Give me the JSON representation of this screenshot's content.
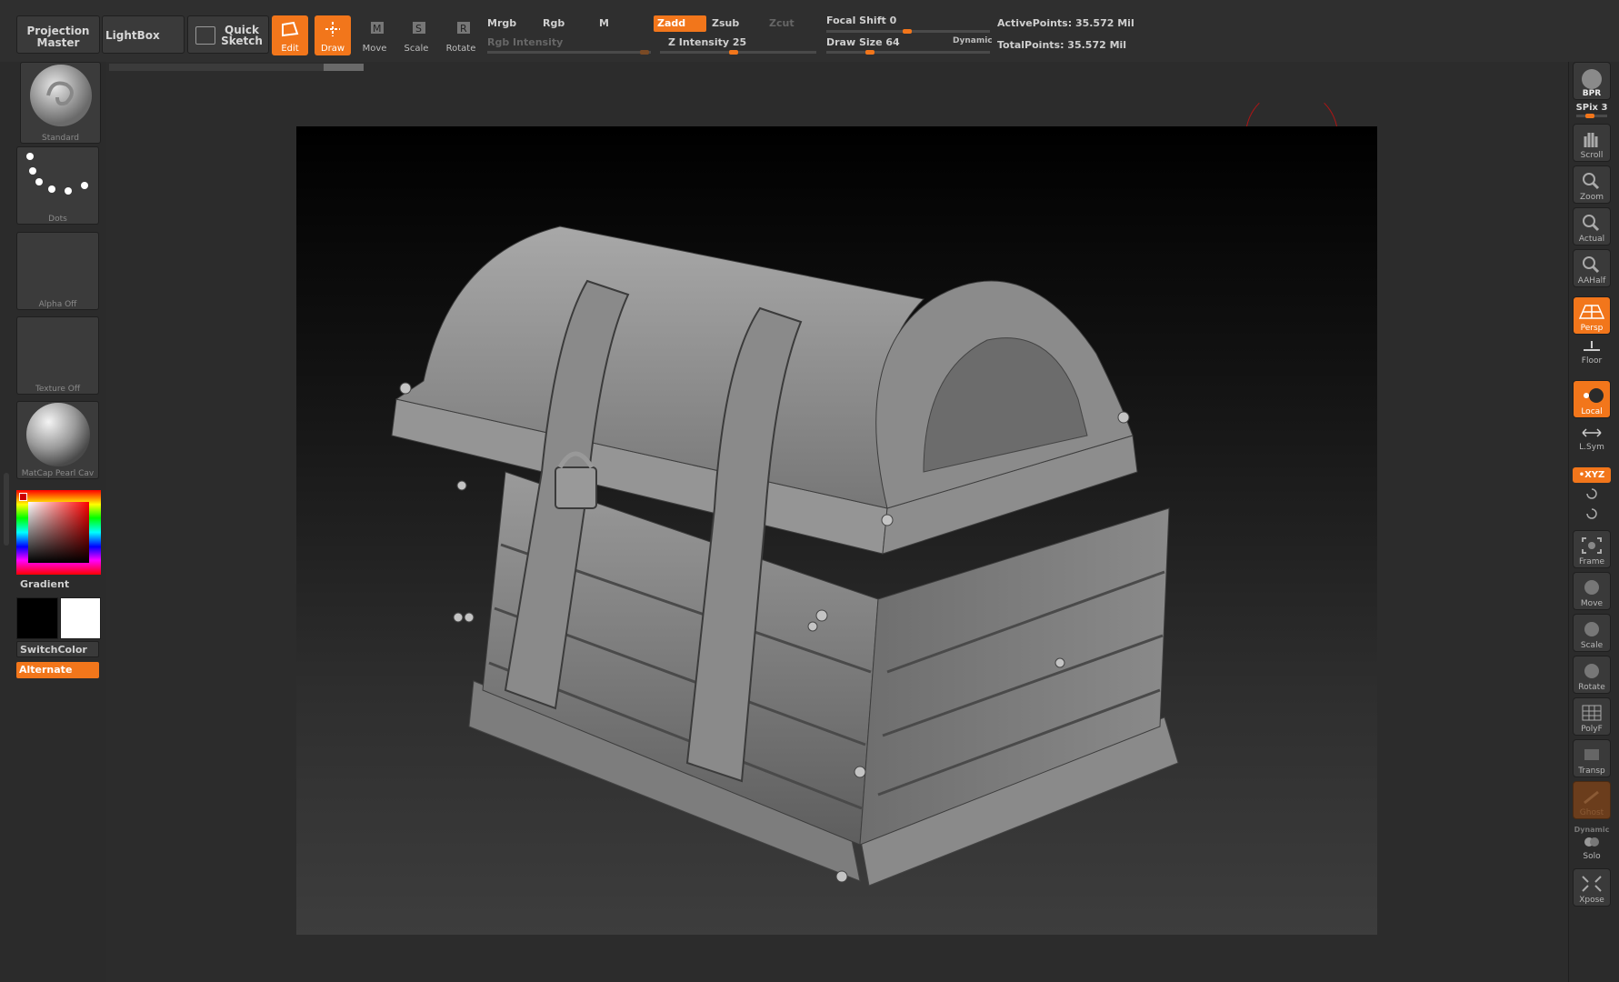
{
  "topbar": {
    "projection_master": [
      "Projection",
      "Master"
    ],
    "lightbox": "LightBox",
    "quick_sketch": [
      "Quick",
      "Sketch"
    ],
    "edit": "Edit",
    "draw": "Draw",
    "move": "Move",
    "scale": "Scale",
    "rotate": "Rotate",
    "mrgb": "Mrgb",
    "rgb": "Rgb",
    "m": "M",
    "zadd": "Zadd",
    "zsub": "Zsub",
    "zcut": "Zcut",
    "rgb_intensity": "Rgb Intensity",
    "z_intensity": "Z Intensity 25",
    "focal_shift": "Focal Shift 0",
    "draw_size": "Draw Size 64",
    "dynamic": "Dynamic",
    "active_points": "ActivePoints: 35.572 Mil",
    "total_points": "TotalPoints: 35.572 Mil"
  },
  "leftpanel": {
    "brush": "Standard",
    "stroke": "Dots",
    "alpha": "Alpha  Off",
    "texture": "Texture  Off",
    "material": "MatCap Pearl Cav",
    "gradient": "Gradient",
    "switchcolor": "SwitchColor",
    "alternate": "Alternate"
  },
  "rightshelf": {
    "bpr": "BPR",
    "spix": "SPix 3",
    "scroll": "Scroll",
    "zoom": "Zoom",
    "actual": "Actual",
    "aahalf": "AAHalf",
    "persp": "Persp",
    "floor": "Floor",
    "local": "Local",
    "lsym": "L.Sym",
    "xyz": "•XYZ",
    "frame": "Frame",
    "move": "Move",
    "scale": "Scale",
    "rotate": "Rotate",
    "polyf": "PolyF",
    "transp": "Transp",
    "ghost": "Ghost",
    "dynamic": "Dynamic",
    "solo": "Solo",
    "xpose": "Xpose"
  },
  "colors": {
    "accent": "#f2761b",
    "panel": "#2b2b2b",
    "button": "#3a3a3a"
  }
}
